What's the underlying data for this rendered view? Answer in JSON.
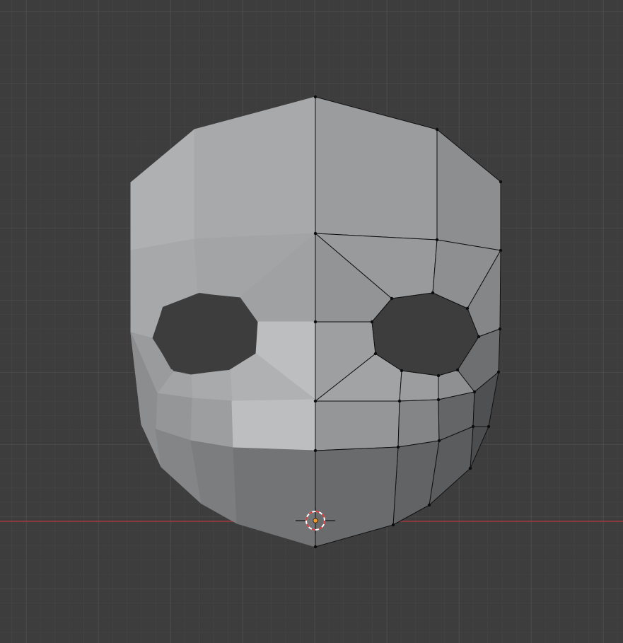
{
  "viewport": {
    "view": "front-orthographic",
    "mode": "edit-mode",
    "colors": {
      "background": "#3d3d3d",
      "grid_minor": "#444444",
      "grid_major": "#4f4f4f",
      "x_axis": "#a13a3e",
      "vertex": "#0d0d0d",
      "edge": "#111111",
      "cursor_red": "#d9383a",
      "cursor_white": "#ffffff",
      "origin": "#f29a2e"
    }
  },
  "mesh": {
    "name": "mask",
    "shading": "solid"
  },
  "cursor": {
    "name": "3d-cursor"
  }
}
